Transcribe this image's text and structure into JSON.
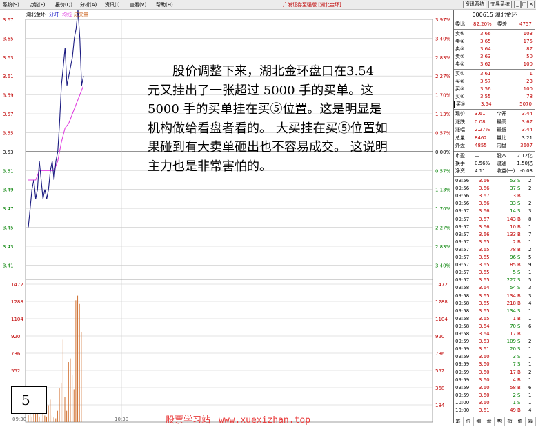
{
  "menubar": {
    "items": [
      "系统(S)",
      "功能(F)",
      "报价(Q)",
      "分析(A)",
      "资讯(I)",
      "查看(V)",
      "帮助(H)"
    ],
    "title": "广发证券至强版 [湖北金环]",
    "buttons": [
      "资讯系统",
      "交易系统"
    ],
    "window_buttons": [
      "_",
      "□",
      "×"
    ]
  },
  "chart_header": {
    "name": "湖北金环",
    "mode": "分时",
    "avg_label": "均线",
    "vol_label": "成交量"
  },
  "colors": {
    "price_line": "#1a1a80",
    "avg_line": "#e040e0",
    "volume": "#d07030",
    "red": "#c00000",
    "green": "#008000",
    "up_axis": "#c00000",
    "down_axis": "#008000"
  },
  "chart_data": {
    "type": "line",
    "title": "",
    "price_axis": [
      "3.67",
      "3.65",
      "3.63",
      "3.61",
      "3.59",
      "3.57",
      "3.55",
      "3.53",
      "3.51",
      "3.49",
      "3.47",
      "3.45",
      "3.43",
      "3.41"
    ],
    "pct_axis": [
      "3.97%",
      "3.40%",
      "2.83%",
      "2.27%",
      "1.70%",
      "1.13%",
      "0.57%",
      "0.00%",
      "0.57%",
      "1.13%",
      "1.70%",
      "2.27%",
      "2.83%",
      "3.40%"
    ],
    "ylim": [
      3.4,
      3.67
    ],
    "prev_close": 3.53,
    "price_series": {
      "name": "分时",
      "x": [
        0,
        1,
        2,
        3,
        4,
        5,
        6,
        7,
        8,
        9,
        10,
        11,
        12,
        13,
        14,
        15,
        16,
        17,
        18,
        19,
        20,
        21,
        22,
        23,
        24,
        25,
        26,
        27,
        28,
        29,
        30
      ],
      "values": [
        3.45,
        3.47,
        3.49,
        3.5,
        3.48,
        3.49,
        3.52,
        3.5,
        3.48,
        3.49,
        3.48,
        3.49,
        3.51,
        3.52,
        3.5,
        3.52,
        3.53,
        3.56,
        3.6,
        3.62,
        3.64,
        3.6,
        3.61,
        3.62,
        3.63,
        3.65,
        3.66,
        3.68,
        3.65,
        3.6,
        3.61
      ]
    },
    "avg_series": {
      "name": "均线",
      "x": [
        0,
        2,
        4,
        6,
        8,
        10,
        12,
        14,
        16,
        18,
        20,
        22,
        24,
        26,
        28,
        30
      ],
      "values": [
        3.5,
        3.5,
        3.5,
        3.51,
        3.51,
        3.51,
        3.51,
        3.51,
        3.52,
        3.54,
        3.555,
        3.56,
        3.57,
        3.58,
        3.59,
        3.6
      ]
    },
    "price_x_span": 30,
    "volume_axis": [
      "1472",
      "1288",
      "1104",
      "920",
      "736",
      "552",
      "368",
      "184"
    ],
    "volume_ylim": [
      0,
      1472
    ],
    "volumes": [
      80,
      150,
      60,
      90,
      120,
      280,
      60,
      40,
      100,
      70,
      60,
      180,
      240,
      70,
      50,
      40,
      120,
      360,
      420,
      880,
      270,
      120,
      640,
      680,
      500,
      350,
      1300,
      1350,
      1260,
      960,
      850
    ],
    "x_labels": [
      "09:30",
      "10:30"
    ]
  },
  "quote": {
    "code": "000615",
    "name": "湖北金环",
    "webi_label": "委比",
    "webi": "82.20%",
    "weicha_label": "委差",
    "weicha": "4757",
    "asks": [
      {
        "label": "卖⑤",
        "price": "3.66",
        "vol": "103"
      },
      {
        "label": "卖④",
        "price": "3.65",
        "vol": "175"
      },
      {
        "label": "卖③",
        "price": "3.64",
        "vol": "87"
      },
      {
        "label": "卖②",
        "price": "3.63",
        "vol": "50"
      },
      {
        "label": "卖①",
        "price": "3.62",
        "vol": "100"
      }
    ],
    "bids": [
      {
        "label": "买①",
        "price": "3.61",
        "vol": "1"
      },
      {
        "label": "买②",
        "price": "3.57",
        "vol": "23"
      },
      {
        "label": "买③",
        "price": "3.56",
        "vol": "100"
      },
      {
        "label": "买④",
        "price": "3.55",
        "vol": "78"
      },
      {
        "label": "买⑤",
        "price": "3.54",
        "vol": "5070"
      }
    ],
    "stats": [
      {
        "l1": "现价",
        "v1": "3.61",
        "l2": "今开",
        "v2": "3.44"
      },
      {
        "l1": "涨跌",
        "v1": "0.08",
        "l2": "最高",
        "v2": "3.67"
      },
      {
        "l1": "涨幅",
        "v1": "2.27%",
        "l2": "最低",
        "v2": "3.44"
      },
      {
        "l1": "总量",
        "v1": "8462",
        "l2": "量比",
        "v2": "3.21"
      },
      {
        "l1": "外盘",
        "v1": "4855",
        "l2": "内盘",
        "v2": "3607"
      }
    ],
    "fin": [
      {
        "l1": "市盈",
        "v1": "—",
        "l2": "股本",
        "v2": "2.12亿"
      },
      {
        "l1": "换手",
        "v1": "0.56%",
        "l2": "流通",
        "v2": "1.50亿"
      },
      {
        "l1": "净资",
        "v1": "4.11",
        "l2": "收益(一)",
        "v2": "-0.03"
      }
    ],
    "ticks": [
      {
        "t": "09:56",
        "p": "3.66",
        "v": "53",
        "d": "S",
        "n": "2"
      },
      {
        "t": "09:56",
        "p": "3.66",
        "v": "37",
        "d": "S",
        "n": "2"
      },
      {
        "t": "09:56",
        "p": "3.67",
        "v": "3",
        "d": "B",
        "n": "1"
      },
      {
        "t": "09:56",
        "p": "3.66",
        "v": "33",
        "d": "S",
        "n": "2"
      },
      {
        "t": "09:57",
        "p": "3.66",
        "v": "14",
        "d": "S",
        "n": "3"
      },
      {
        "t": "09:57",
        "p": "3.67",
        "v": "143",
        "d": "B",
        "n": "8"
      },
      {
        "t": "09:57",
        "p": "3.66",
        "v": "10",
        "d": "B",
        "n": "1"
      },
      {
        "t": "09:57",
        "p": "3.66",
        "v": "133",
        "d": "B",
        "n": "7"
      },
      {
        "t": "09:57",
        "p": "3.65",
        "v": "2",
        "d": "B",
        "n": "1"
      },
      {
        "t": "09:57",
        "p": "3.65",
        "v": "78",
        "d": "B",
        "n": "2"
      },
      {
        "t": "09:57",
        "p": "3.65",
        "v": "96",
        "d": "S",
        "n": "5"
      },
      {
        "t": "09:57",
        "p": "3.65",
        "v": "85",
        "d": "B",
        "n": "9"
      },
      {
        "t": "09:57",
        "p": "3.65",
        "v": "5",
        "d": "S",
        "n": "1"
      },
      {
        "t": "09:57",
        "p": "3.65",
        "v": "227",
        "d": "S",
        "n": "5"
      },
      {
        "t": "09:58",
        "p": "3.64",
        "v": "54",
        "d": "S",
        "n": "3"
      },
      {
        "t": "09:58",
        "p": "3.65",
        "v": "134",
        "d": "B",
        "n": "3"
      },
      {
        "t": "09:58",
        "p": "3.65",
        "v": "218",
        "d": "B",
        "n": "4"
      },
      {
        "t": "09:58",
        "p": "3.65",
        "v": "134",
        "d": "S",
        "n": "1"
      },
      {
        "t": "09:58",
        "p": "3.65",
        "v": "1",
        "d": "B",
        "n": "1"
      },
      {
        "t": "09:58",
        "p": "3.64",
        "v": "70",
        "d": "S",
        "n": "6"
      },
      {
        "t": "09:58",
        "p": "3.64",
        "v": "17",
        "d": "B",
        "n": "1"
      },
      {
        "t": "09:59",
        "p": "3.63",
        "v": "109",
        "d": "S",
        "n": "2"
      },
      {
        "t": "09:59",
        "p": "3.61",
        "v": "20",
        "d": "S",
        "n": "1"
      },
      {
        "t": "09:59",
        "p": "3.60",
        "v": "3",
        "d": "S",
        "n": "1"
      },
      {
        "t": "09:59",
        "p": "3.60",
        "v": "7",
        "d": "S",
        "n": "1"
      },
      {
        "t": "09:59",
        "p": "3.60",
        "v": "17",
        "d": "B",
        "n": "2"
      },
      {
        "t": "09:59",
        "p": "3.60",
        "v": "4",
        "d": "B",
        "n": "1"
      },
      {
        "t": "09:59",
        "p": "3.60",
        "v": "58",
        "d": "B",
        "n": "6"
      },
      {
        "t": "09:59",
        "p": "3.60",
        "v": "2",
        "d": "S",
        "n": "1"
      },
      {
        "t": "10:00",
        "p": "3.60",
        "v": "1",
        "d": "S",
        "n": "1"
      },
      {
        "t": "10:00",
        "p": "3.61",
        "v": "49",
        "d": "B",
        "n": "4"
      }
    ],
    "tabs": [
      "笔",
      "价",
      "细",
      "盘",
      "势",
      "指",
      "值",
      "筹"
    ]
  },
  "annotation": {
    "text": "股价调整下来，湖北金环盘口在3.54 元又挂出了一张超过 5000 手的买单。这 5000 手的买单挂在买⑤位置。这是明显是机构做给看盘者看的。 大买挂在买⑤位置如果碰到有大卖单砸出也不容易成交。 这说明主力也是非常害怕的。"
  },
  "page_number": "5",
  "watermark": {
    "text": "股票学习站",
    "url": "www.xuexizhan.top"
  }
}
